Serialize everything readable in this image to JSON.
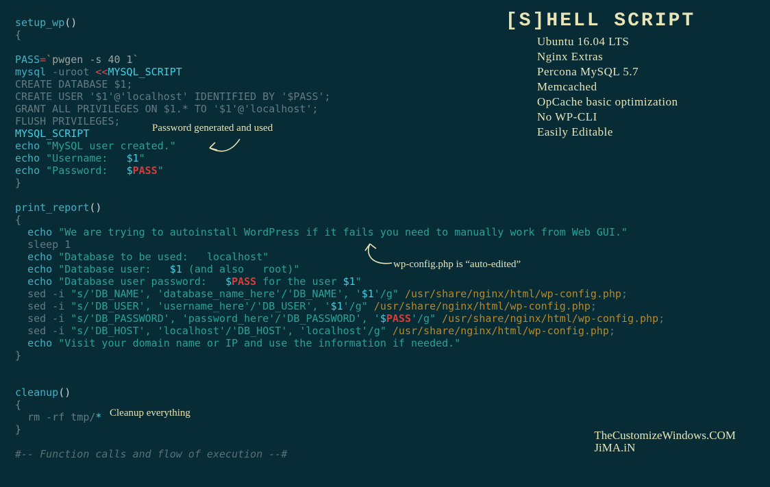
{
  "title": "[S]HELL SCRIPT",
  "features": [
    "Ubuntu 16.04 LTS",
    "Nginx Extras",
    "Percona MySQL 5.7",
    "Memcached",
    "OpCache basic optimization",
    "No WP-CLI",
    "Easily Editable"
  ],
  "credits": [
    "TheCustomizeWindows.COM",
    "JiMA.iN"
  ],
  "annotations": {
    "pwd": "Password generated and used",
    "wp": "wp-config.php is “auto-edited”",
    "cleanup": "Cleanup everything"
  },
  "code": {
    "l1": "setup_wp",
    "l2": "{",
    "l3_a": "PASS",
    "l3_b": "=",
    "l3_c": "`pwgen -s 40 1`",
    "l4_a": "mysql",
    "l4_b": " -uroot ",
    "l4_c": "<<",
    "l4_d": "MYSQL_SCRIPT",
    "l5": "CREATE DATABASE $1;",
    "l6": "CREATE USER '$1'@'localhost' IDENTIFIED BY '$PASS';",
    "l7": "GRANT ALL PRIVILEGES ON $1.* TO '$1'@'localhost';",
    "l8": "FLUSH PRIVILEGES;",
    "l9": "MYSQL_SCRIPT",
    "l10_a": "echo",
    "l10_b": "\"MySQL user created.\"",
    "l11_a": "echo",
    "l11_b": "\"Username:   ",
    "l11_c": "$1",
    "l11_d": "\"",
    "l12_a": "echo",
    "l12_b": "\"Password:   ",
    "l12_c": "$",
    "l12_d": "PASS",
    "l12_e": "\"",
    "l13": "}",
    "l15": "print_report",
    "l16": "{",
    "l17_a": "echo",
    "l17_b": "\"We are trying to autoinstall WordPress if it fails you need to manually work from Web GUI.\"",
    "l18": "sleep 1",
    "l19_a": "echo",
    "l19_b": "\"Database to be used:   localhost\"",
    "l20_a": "echo",
    "l20_b": "\"Database user:   ",
    "l20_c": "$1",
    "l20_d": " (and also   root)\"",
    "l21_a": "echo",
    "l21_b": "\"Database user password:   ",
    "l21_c": "$",
    "l21_d": "PASS",
    "l21_e": " for the user ",
    "l21_f": "$1",
    "l21_g": "\"",
    "sed1_a": "sed -i ",
    "sed1_b": "\"s/'DB_NAME', 'database_name_here'/'DB_NAME', '",
    "sed1_c": "$1",
    "sed1_d": "'/g\"",
    "sed1_e": " /usr/share/nginx/html/wp-config.php",
    "sed1_f": ";",
    "sed2_a": "sed -i ",
    "sed2_b": "\"s/'DB_USER', 'username_here'/'DB_USER', '",
    "sed2_c": "$1",
    "sed2_d": "'/g\"",
    "sed2_e": " /usr/share/nginx/html/wp-config.php",
    "sed2_f": ";",
    "sed3_a": "sed -i ",
    "sed3_b": "\"s/'DB_PASSWORD', 'password_here'/'DB_PASSWORD', '",
    "sed3_c": "$",
    "sed3_d": "PASS",
    "sed3_e": "'/g\"",
    "sed3_f": " /usr/share/nginx/html/wp-config.php",
    "sed3_g": ";",
    "sed4_a": "sed -i ",
    "sed4_b": "\"s/'DB_HOST', 'localhost'/'DB_HOST', 'localhost'/g\"",
    "sed4_c": " /usr/share/nginx/html/wp-config.php",
    "sed4_d": ";",
    "l26_a": "echo",
    "l26_b": "\"Visit your domain name or IP and use the information if needed.\"",
    "l27": "}",
    "l30": "cleanup",
    "l31": "{",
    "l32_a": "rm -rf tmp/",
    "l32_b": "*",
    "l33": "}",
    "l35": "#-- Function calls and flow of execution --#"
  }
}
